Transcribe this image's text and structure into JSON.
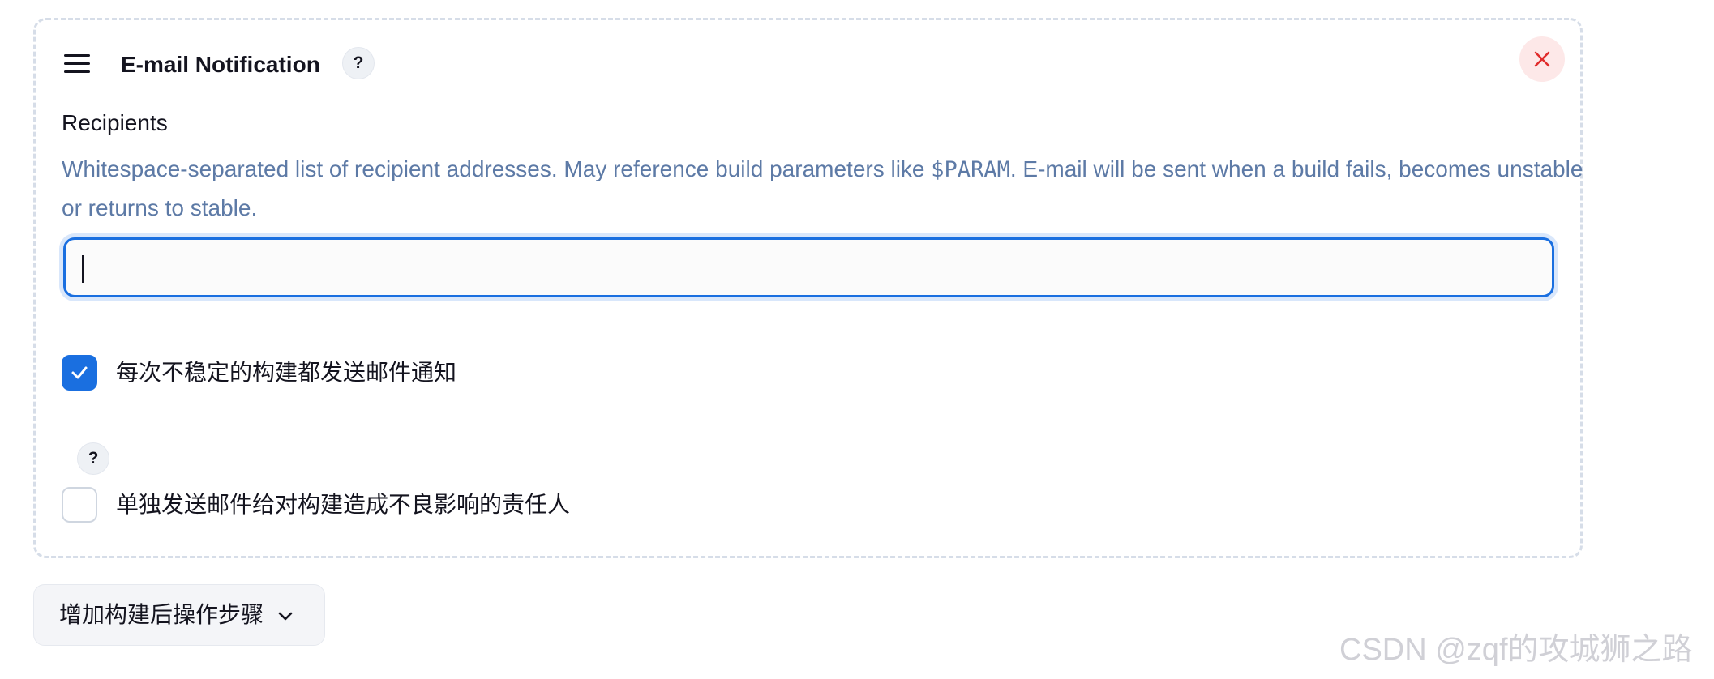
{
  "section": {
    "title": "E-mail Notification",
    "help_glyph": "?",
    "drag_icon": "hamburger-drag-icon",
    "close_icon": "close-x-icon"
  },
  "recipients": {
    "label": "Recipients",
    "description_part1": "Whitespace-separated list of recipient addresses. May reference build parameters like ",
    "description_code": "$PARAM",
    "description_part2": ". E-mail will be sent when a build fails, becomes unstable or returns to stable.",
    "value": ""
  },
  "options": [
    {
      "label": "每次不稳定的构建都发送邮件通知",
      "checked": true
    },
    {
      "label": "单独发送邮件给对构建造成不良影响的责任人",
      "checked": false,
      "help_glyph": "?"
    }
  ],
  "add_step": {
    "label": "增加构建后操作步骤",
    "icon": "chevron-down-icon"
  },
  "watermark": "CSDN @zqf的攻城狮之路",
  "colors": {
    "accent": "#1a6fe0",
    "description": "#5d7aa6",
    "close": "#e02b2b",
    "close_bg": "#fde8e8",
    "section_border": "#d6dde8"
  }
}
